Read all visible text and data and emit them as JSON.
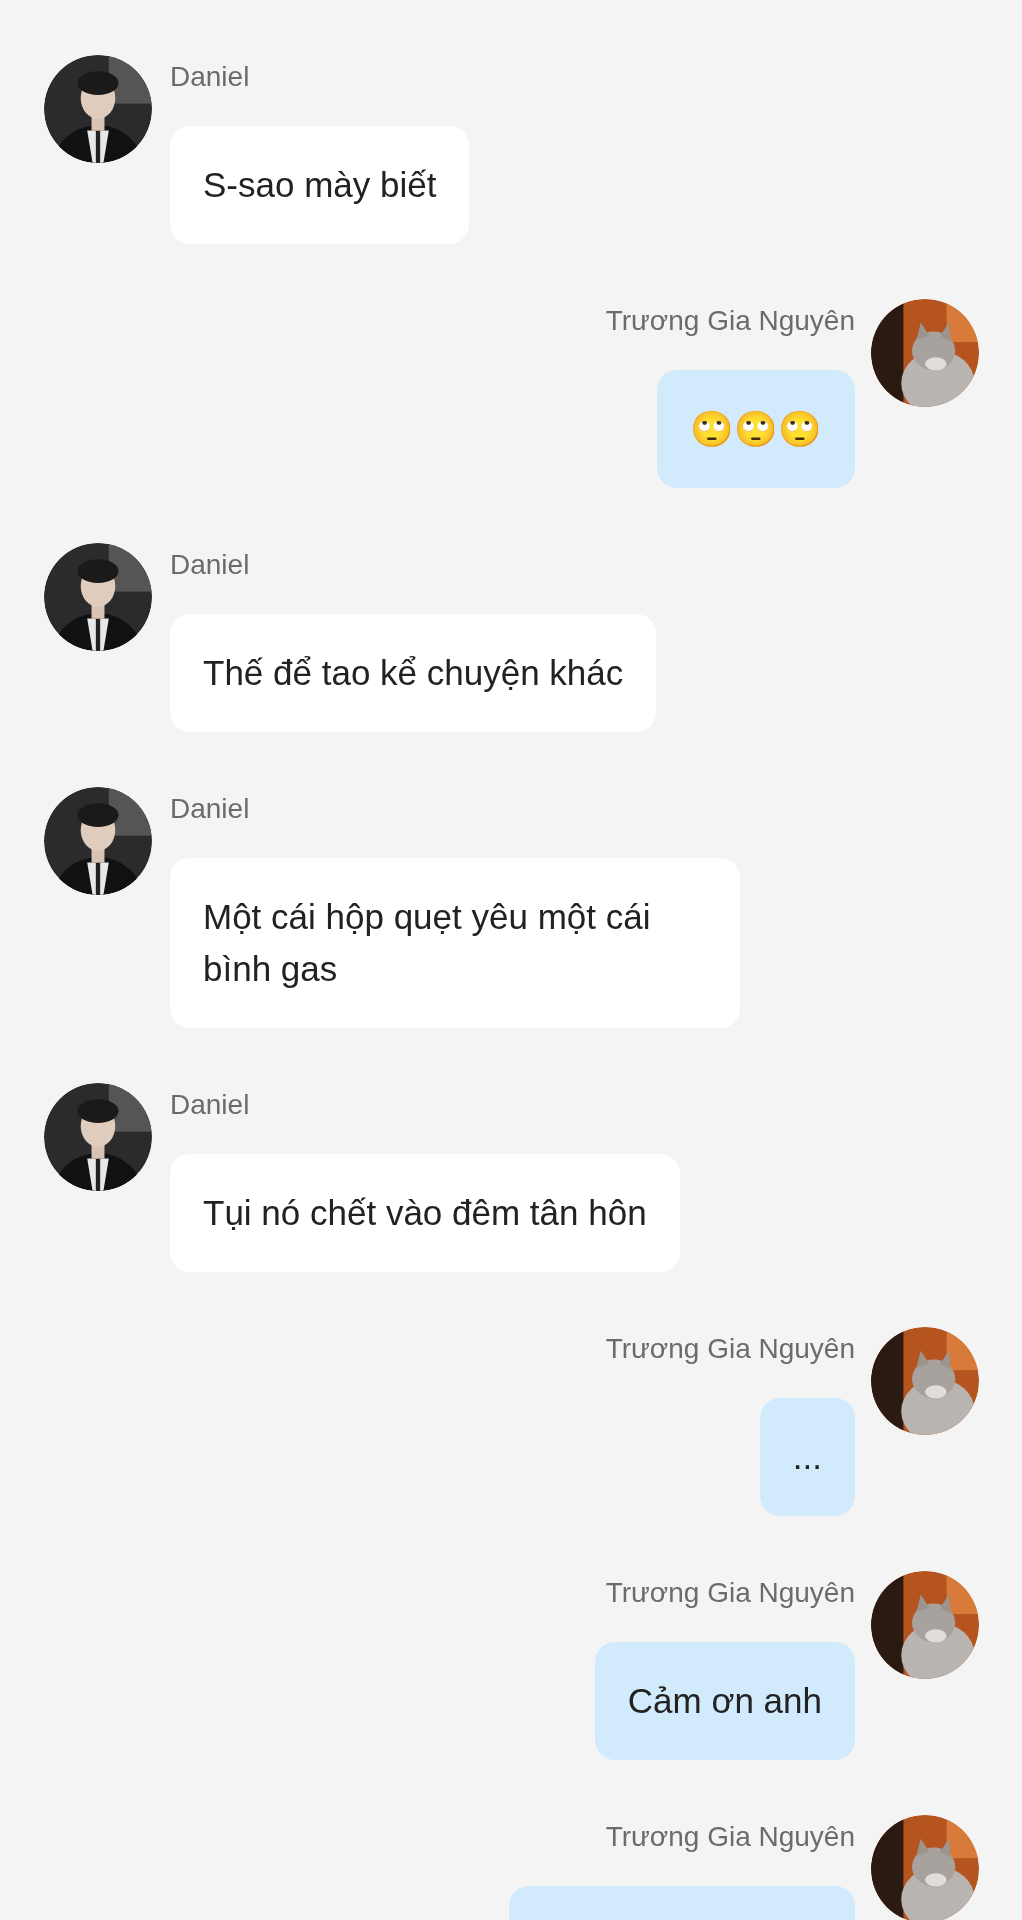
{
  "messages": [
    {
      "sender": "Daniel",
      "kind": "incoming",
      "text": "S-sao mày biết"
    },
    {
      "sender": "Trương Gia Nguyên",
      "kind": "outgoing",
      "text": "🙄🙄🙄"
    },
    {
      "sender": "Daniel",
      "kind": "incoming",
      "text": "Thế để tao kể chuyện khác"
    },
    {
      "sender": "Daniel",
      "kind": "incoming",
      "text": "Một cái hộp quẹt yêu một cái bình gas"
    },
    {
      "sender": "Daniel",
      "kind": "incoming",
      "text": "Tụi nó chết vào đêm tân hôn"
    },
    {
      "sender": "Trương Gia Nguyên",
      "kind": "outgoing",
      "text": "..."
    },
    {
      "sender": "Trương Gia Nguyên",
      "kind": "outgoing",
      "text": "Cảm ơn anh"
    },
    {
      "sender": "Trương Gia Nguyên",
      "kind": "outgoing"
    }
  ]
}
